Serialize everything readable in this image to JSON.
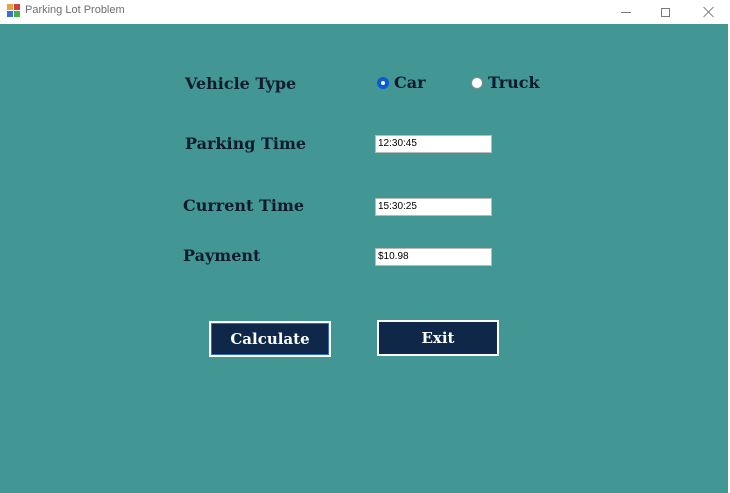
{
  "window": {
    "title": "Parking Lot Problem",
    "controls": {
      "minimize_icon": "minimize-icon",
      "maximize_icon": "maximize-icon",
      "close_icon": "close-icon"
    }
  },
  "colors": {
    "background": "#429694",
    "label_text": "#0e1a2e",
    "button_bg": "#0f2748",
    "button_text": "#ffffff",
    "radio_checked": "#0a5bd3"
  },
  "form": {
    "vehicle_type_label": "Vehicle Type",
    "vehicle_options": [
      {
        "label": "Car",
        "checked": true
      },
      {
        "label": "Truck",
        "checked": false
      }
    ],
    "parking_time_label": "Parking Time",
    "parking_time_value": "12:30:45",
    "current_time_label": "Current Time",
    "current_time_value": "15:30:25",
    "payment_label": "Payment",
    "payment_value": "$10.98"
  },
  "buttons": {
    "calculate_label": "Calculate",
    "exit_label": "Exit"
  }
}
